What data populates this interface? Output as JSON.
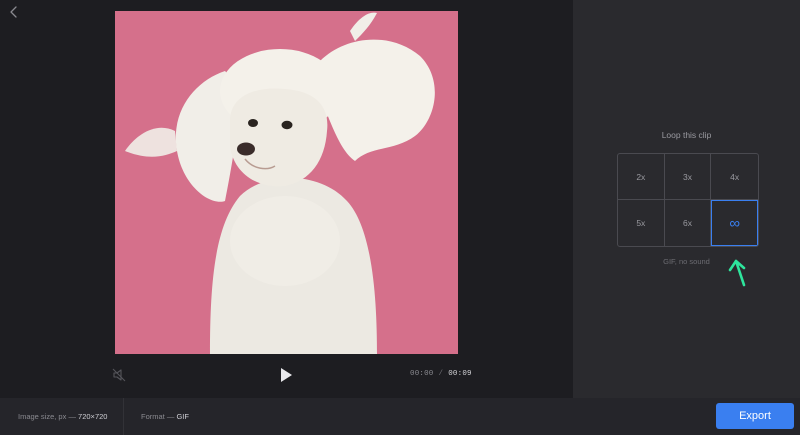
{
  "editor": {
    "back_icon": "chevron-left-icon",
    "preview_description": "video frame",
    "mute_icon": "speaker-muted-icon",
    "play_icon": "play-icon",
    "time_current": "00:00",
    "time_separator": "/",
    "time_total": "00:09"
  },
  "loop_panel": {
    "title": "Loop this clip",
    "options": [
      {
        "label": "2x",
        "selected": false
      },
      {
        "label": "3x",
        "selected": false
      },
      {
        "label": "4x",
        "selected": false
      },
      {
        "label": "5x",
        "selected": false
      },
      {
        "label": "6x",
        "selected": false
      },
      {
        "label": "∞",
        "selected": true
      }
    ],
    "note": "GIF, no sound",
    "arrow_icon": "arrow-up-icon"
  },
  "footer": {
    "size_label": "Image size, px —",
    "size_value": "720×720",
    "format_label": "Format —",
    "format_value": "GIF",
    "export_label": "Export"
  },
  "colors": {
    "accent": "#3a7ff0",
    "annotation_arrow": "#2ee59d",
    "preview_background": "#d9738c"
  }
}
